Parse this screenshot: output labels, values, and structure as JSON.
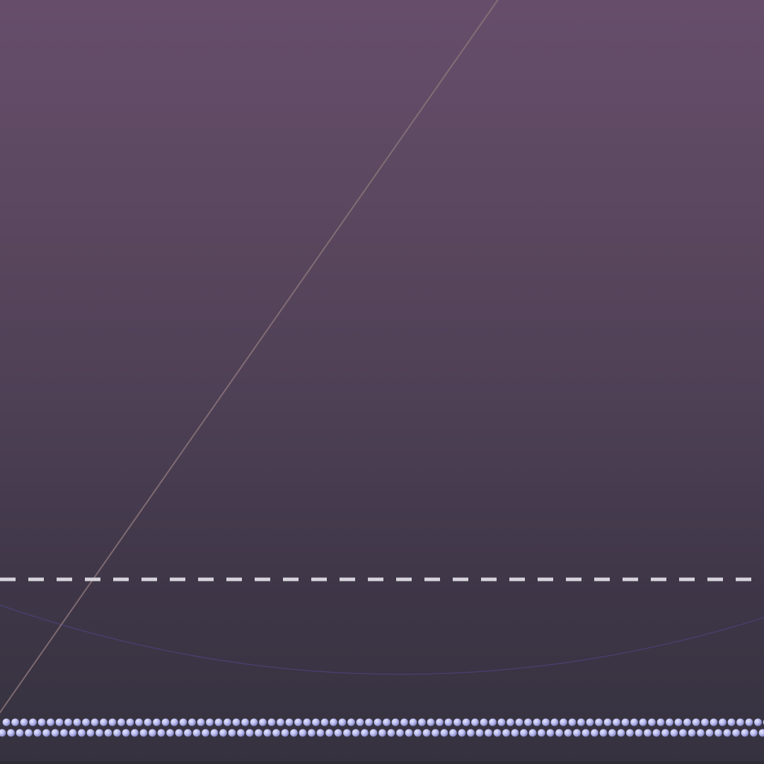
{
  "scene": {
    "background_top": "#664e6b",
    "background_bottom": "#35323f",
    "diagonal_line_color": "#8a7478",
    "arc_color": "#4a4070",
    "dashed_line_color": "#d7d3dc",
    "bead_color_light": "#e6e6ff",
    "bead_color_mid": "#b4b6ea",
    "bead_color_dark": "#6c6fae",
    "bead_rows": 2
  }
}
